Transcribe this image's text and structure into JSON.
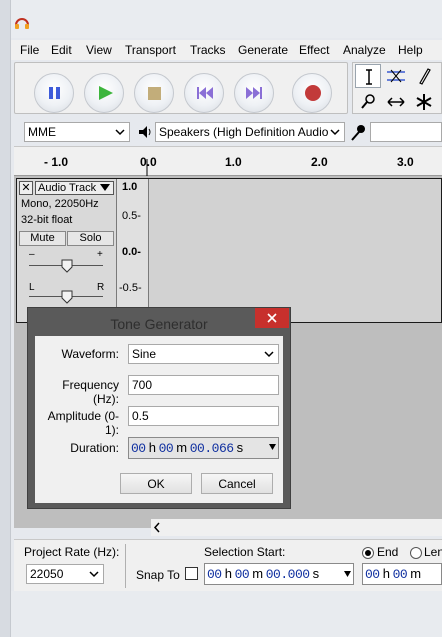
{
  "menu": [
    "File",
    "Edit",
    "View",
    "Transport",
    "Tracks",
    "Generate",
    "Effect",
    "Analyze",
    "Help"
  ],
  "device": {
    "host": "MME",
    "output": "Speakers (High Definition Audio"
  },
  "ruler": {
    "ticks": [
      "- 1.0",
      "0.0",
      "1.0",
      "2.0",
      "3.0"
    ]
  },
  "track": {
    "close_glyph": "✕",
    "name": "Audio Track",
    "info_line1": "Mono, 22050Hz",
    "info_line2": "32-bit float",
    "mute_label": "Mute",
    "solo_label": "Solo",
    "gain_minus": "–",
    "gain_plus": "+",
    "pan_left": "L",
    "pan_right": "R",
    "y_labels": [
      "1.0",
      "0.5-",
      "0.0-",
      "-0.5-"
    ]
  },
  "dialog": {
    "title": "Tone Generator",
    "waveform_label": "Waveform:",
    "waveform_value": "Sine",
    "frequency_label": "Frequency (Hz):",
    "frequency_value": "700",
    "amplitude_label": "Amplitude (0-1):",
    "amplitude_value": "0.5",
    "duration_label": "Duration:",
    "duration": {
      "h": "00",
      "m": "00",
      "s": "00.066"
    },
    "ok_label": "OK",
    "cancel_label": "Cancel"
  },
  "selection": {
    "project_rate_label": "Project Rate (Hz):",
    "project_rate_value": "22050",
    "snap_to_label": "Snap To",
    "selection_start_label": "Selection Start:",
    "end_label": "End",
    "length_label": "Len",
    "start_time": {
      "h": "00",
      "m": "00",
      "s": "00.000"
    },
    "end_time": {
      "h": "00",
      "m": "00"
    }
  },
  "colors": {
    "play_green": "#3db53d",
    "pause_blue": "#3d5bd9",
    "record_red": "#c23a3a",
    "skip_purple": "#8a6fd6",
    "stop_tan": "#c2ad7a",
    "timecode_blue": "#1030a0",
    "close_red": "#c7302c"
  },
  "icons": [
    "audacity-icon",
    "pause-icon",
    "play-icon",
    "stop-icon",
    "skip-start-icon",
    "skip-end-icon",
    "record-icon",
    "selection-tool-icon",
    "envelope-tool-icon",
    "draw-tool-icon",
    "zoom-tool-icon",
    "timeshift-tool-icon",
    "multi-tool-icon",
    "speaker-icon",
    "microphone-icon"
  ]
}
